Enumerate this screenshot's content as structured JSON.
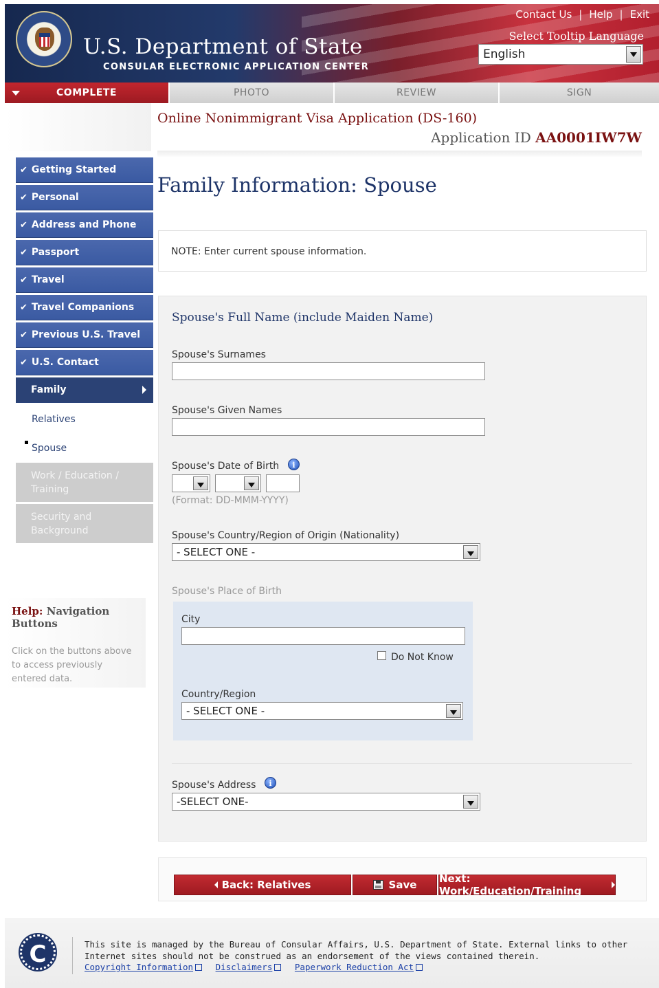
{
  "header": {
    "top_links": [
      "Contact Us",
      "Help",
      "Exit"
    ],
    "dept_title": "U.S. Department of State",
    "dept_subtitle": "CONSULAR ELECTRONIC APPLICATION CENTER",
    "tooltip_language_label": "Select Tooltip Language",
    "tooltip_language_value": "English"
  },
  "progress_tabs": [
    {
      "label": "COMPLETE",
      "active": true
    },
    {
      "label": "PHOTO",
      "active": false
    },
    {
      "label": "REVIEW",
      "active": false
    },
    {
      "label": "SIGN",
      "active": false
    }
  ],
  "form_title": "Online Nonimmigrant Visa Application (DS-160)",
  "application_id_label": "Application ID",
  "application_id": "AA0001IW7W",
  "sidebar": {
    "completed": [
      "Getting Started",
      "Personal",
      "Address and Phone",
      "Passport",
      "Travel",
      "Travel Companions",
      "Previous U.S. Travel",
      "U.S. Contact"
    ],
    "current": "Family",
    "sub_items": [
      "Relatives",
      "Spouse"
    ],
    "disabled": [
      {
        "line1": "Work / Education /",
        "line2": "Training"
      },
      {
        "line1": "Security and",
        "line2": "Background"
      }
    ]
  },
  "help": {
    "prefix": "Help:",
    "title": "Navigation Buttons",
    "text": "Click on the buttons above to access previously entered data."
  },
  "page_heading": "Family Information: Spouse",
  "note": "NOTE: Enter current spouse information.",
  "form": {
    "full_name_heading": "Spouse's Full Name (include Maiden Name)",
    "surnames_label": "Spouse's Surnames",
    "surnames_value": "",
    "given_names_label": "Spouse's Given Names",
    "given_names_value": "",
    "dob_label": "Spouse's Date of Birth",
    "dob_format": "(Format: DD-MMM-YYYY)",
    "nationality_label": "Spouse's Country/Region of Origin (Nationality)",
    "nationality_value": "- SELECT ONE -",
    "pob_label": "Spouse's Place of Birth",
    "city_label": "City",
    "do_not_know_label": "Do Not Know",
    "country_label": "Country/Region",
    "country_value": "- SELECT ONE -",
    "address_label": "Spouse's Address",
    "address_value": "-SELECT ONE-"
  },
  "buttons": {
    "back": "Back: Relatives",
    "save": "Save",
    "next": "Next: Work/Education/Training"
  },
  "footer": {
    "text": "This site is managed by the Bureau of Consular Affairs, U.S. Department of State. External links to other Internet sites should not be construed as an endorsement of the views contained therein.",
    "links": [
      "Copyright Information",
      "Disclaimers",
      "Paperwork Reduction Act"
    ]
  }
}
